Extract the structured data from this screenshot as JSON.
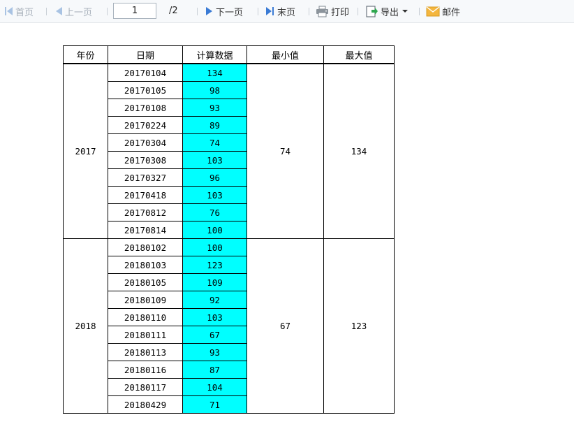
{
  "toolbar": {
    "first": "首页",
    "prev": "上一页",
    "page_value": "1",
    "total_pages": "/2",
    "next": "下一页",
    "last": "末页",
    "print": "打印",
    "export": "导出",
    "mail": "邮件"
  },
  "table": {
    "headers": [
      "年份",
      "日期",
      "计算数据",
      "最小值",
      "最大值"
    ],
    "groups": [
      {
        "year": "2017",
        "min": "74",
        "max": "134",
        "rows": [
          {
            "date": "20170104",
            "value": "134"
          },
          {
            "date": "20170105",
            "value": "98"
          },
          {
            "date": "20170108",
            "value": "93"
          },
          {
            "date": "20170224",
            "value": "89"
          },
          {
            "date": "20170304",
            "value": "74"
          },
          {
            "date": "20170308",
            "value": "103"
          },
          {
            "date": "20170327",
            "value": "96"
          },
          {
            "date": "20170418",
            "value": "103"
          },
          {
            "date": "20170812",
            "value": "76"
          },
          {
            "date": "20170814",
            "value": "100"
          }
        ]
      },
      {
        "year": "2018",
        "min": "67",
        "max": "123",
        "rows": [
          {
            "date": "20180102",
            "value": "100"
          },
          {
            "date": "20180103",
            "value": "123"
          },
          {
            "date": "20180105",
            "value": "109"
          },
          {
            "date": "20180109",
            "value": "92"
          },
          {
            "date": "20180110",
            "value": "103"
          },
          {
            "date": "20180111",
            "value": "67"
          },
          {
            "date": "20180113",
            "value": "93"
          },
          {
            "date": "20180116",
            "value": "87"
          },
          {
            "date": "20180117",
            "value": "104"
          },
          {
            "date": "20180429",
            "value": "71"
          }
        ]
      }
    ]
  },
  "colors": {
    "value_cell": "#00ffff",
    "accent_blue": "#3a7bd5",
    "disabled": "#a7b0ba"
  }
}
